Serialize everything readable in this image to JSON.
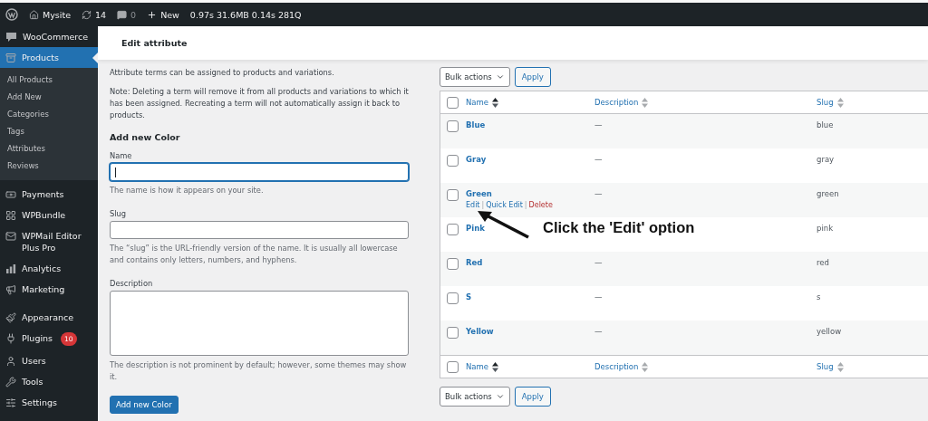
{
  "admin_bar": {
    "site": "Mysite",
    "updates": "14",
    "comments": "0",
    "new": "New",
    "stats": "0.97s 31.6MB 0.14s 281Q"
  },
  "sidebar": {
    "sections": [
      {
        "items": [
          {
            "label": "WooCommerce",
            "selected": false
          },
          {
            "label": "Products",
            "selected": true,
            "children": [
              {
                "label": "All Products"
              },
              {
                "label": "Add New"
              },
              {
                "label": "Categories"
              },
              {
                "label": "Tags"
              },
              {
                "label": "Attributes"
              },
              {
                "label": "Reviews"
              }
            ]
          }
        ]
      },
      {
        "items": [
          {
            "label": "Payments",
            "selected": false
          },
          {
            "label": "WPBundle",
            "selected": false
          },
          {
            "label": "WPMail Editor Plus Pro",
            "selected": false
          },
          {
            "label": "Analytics",
            "selected": false
          },
          {
            "label": "Marketing",
            "selected": false
          }
        ]
      },
      {
        "items": [
          {
            "label": "Appearance",
            "selected": false
          },
          {
            "label": "Plugins",
            "selected": false,
            "badge": "10"
          },
          {
            "label": "Users",
            "selected": false
          },
          {
            "label": "Tools",
            "selected": false
          },
          {
            "label": "Settings",
            "selected": false
          }
        ]
      }
    ]
  },
  "page_title": "Edit attribute",
  "intro": [
    "Attribute terms can be assigned to products and variations.",
    "Note: Deleting a term will remove it from all products and variations to which it has been assigned. Recreating a term will not automatically assign it back to products."
  ],
  "form": {
    "heading": "Add new Color",
    "fields": [
      {
        "label": "Name",
        "kind": "input",
        "focused": true,
        "hint": "The name is how it appears on your site."
      },
      {
        "label": "Slug",
        "kind": "input",
        "focused": false,
        "hint": "The “slug” is the URL-friendly version of the name. It is usually all lowercase and contains only letters, numbers, and hyphens."
      },
      {
        "label": "Description",
        "kind": "textarea",
        "focused": false,
        "hint": "The description is not prominent by default; however, some themes may show it."
      }
    ],
    "submit": "Add new Color"
  },
  "table": {
    "top_actions": {
      "bulk": "Bulk actions",
      "apply": "Apply"
    },
    "select_all_checked": false,
    "columns": [
      {
        "label": "Name",
        "sorted": true
      },
      {
        "label": "Description",
        "sorted": false
      },
      {
        "label": "Slug",
        "sorted": false
      }
    ],
    "action_separator": "|",
    "rows": [
      {
        "name": "Blue",
        "description": "—",
        "slug": "blue",
        "checked": false
      },
      {
        "name": "Gray",
        "description": "—",
        "slug": "gray",
        "checked": false
      },
      {
        "name": "Green",
        "description": "—",
        "slug": "green",
        "checked": false,
        "row_actions": [
          {
            "label": "Edit",
            "kind": "link"
          },
          {
            "label": "Quick Edit",
            "kind": "link"
          },
          {
            "label": "Delete",
            "kind": "delete"
          }
        ]
      },
      {
        "name": "Pink",
        "slug": "pink",
        "checked": false
      },
      {
        "name": "Red",
        "description": "—",
        "slug": "red",
        "checked": false
      },
      {
        "name": "S",
        "description": "—",
        "slug": "s",
        "checked": false
      },
      {
        "name": "Yellow",
        "description": "—",
        "slug": "yellow",
        "checked": false
      }
    ],
    "footer_select_all_checked": false,
    "footer_columns": [
      {
        "label": "Name",
        "sorted": true
      },
      {
        "label": "Description",
        "sorted": false
      },
      {
        "label": "Slug",
        "sorted": false
      }
    ],
    "bottom_actions": {
      "bulk": "Bulk actions",
      "apply": "Apply"
    }
  },
  "annotation": {
    "text": "Click the 'Edit' option"
  }
}
